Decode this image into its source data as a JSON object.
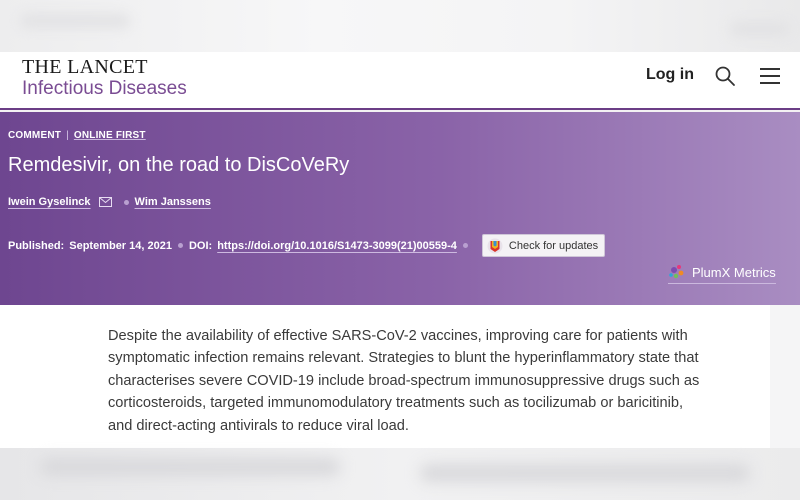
{
  "header": {
    "logo_line1": "THE LANCET",
    "logo_line2": "Infectious Diseases",
    "login_label": "Log in",
    "search_icon": "search-icon",
    "menu_icon": "hamburger-menu-icon"
  },
  "article": {
    "type": "COMMENT",
    "status": "ONLINE FIRST",
    "title": "Remdesivir, on the road to DisCoVeRy",
    "authors": [
      {
        "name": "Iwein Gyselinck",
        "icon": "envelope-icon"
      },
      {
        "name": "Wim Janssens"
      }
    ],
    "published_label": "Published:",
    "published_date": "September 14, 2021",
    "doi_label": "DOI:",
    "doi_url": "https://doi.org/10.1016/S1473-3099(21)00559-4",
    "check_updates_label": "Check for updates",
    "plumx_label": "PlumX Metrics",
    "abstract": "Despite the availability of effective SARS-CoV-2 vaccines, improving care for patients with symptomatic infection remains relevant. Strategies to blunt the hyperinflammatory state that characterises severe COVID-19 include broad-spectrum immunosuppressive drugs such as corticosteroids, targeted immunomodulatory treatments such as tocilizumab or baricitinib, and direct-acting antivirals to reduce viral load."
  },
  "colors": {
    "brand_purple": "#7a4c93",
    "banner_start": "#6e4690",
    "banner_end": "#a98dc2"
  }
}
